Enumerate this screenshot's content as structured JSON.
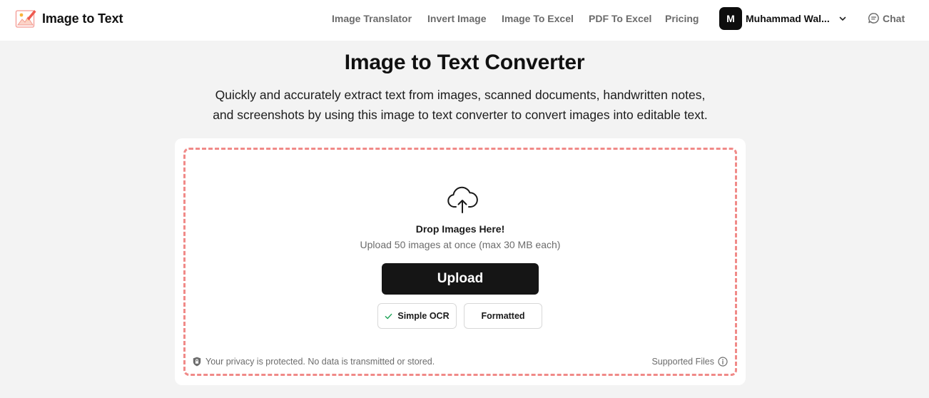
{
  "brand": {
    "name": "Image to Text",
    "logo_icon": "pencil-picture-logo"
  },
  "nav": {
    "items": [
      {
        "label": "Image Translator"
      },
      {
        "label": "Invert Image"
      },
      {
        "label": "Image To Excel"
      },
      {
        "label": "PDF To Excel"
      },
      {
        "label": "Pricing"
      }
    ]
  },
  "user": {
    "initial": "M",
    "name": "Muhammad Wal...",
    "menu_icon": "chevron-down-icon"
  },
  "chat": {
    "label": "Chat",
    "icon": "chat-bubble-icon"
  },
  "hero": {
    "title": "Image to Text Converter",
    "subtitle_line1": "Quickly and accurately extract text from images, scanned documents, handwritten notes,",
    "subtitle_line2": "and screenshots by using this image to text converter to convert images into editable text."
  },
  "uploader": {
    "icon": "cloud-upload-icon",
    "drop_title": "Drop Images Here!",
    "drop_subtitle": "Upload 50 images at once (max 30 MB each)",
    "upload_label": "Upload",
    "modes": [
      {
        "label": "Simple OCR",
        "selected": true
      },
      {
        "label": "Formatted",
        "selected": false
      }
    ],
    "privacy_text": "Your privacy is protected. No data is transmitted or stored.",
    "supported_label": "Supported Files"
  },
  "colors": {
    "accent_dash": "#f08a88",
    "button_dark": "#151515",
    "check_green": "#22a55a",
    "page_bg": "#f3f3f3"
  }
}
